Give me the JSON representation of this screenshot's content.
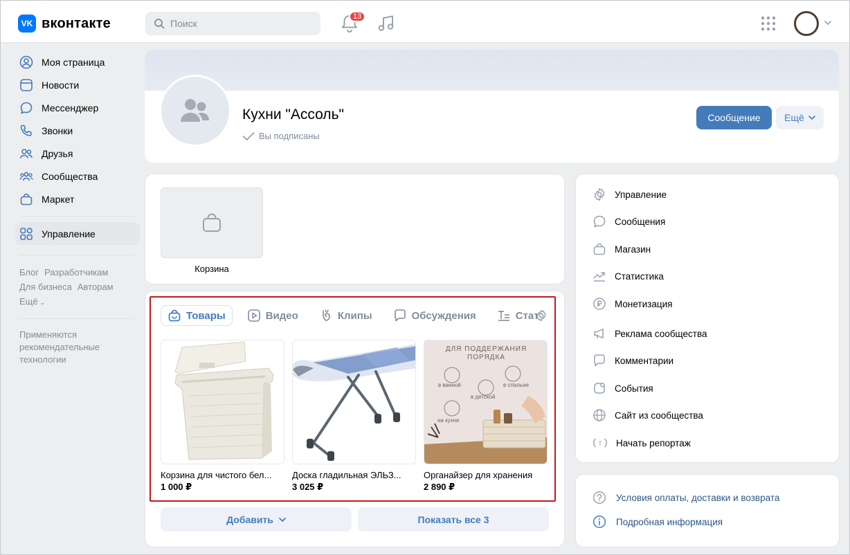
{
  "header": {
    "logo_badge": "VK",
    "logo_text": "вконтакте",
    "search_placeholder": "Поиск",
    "notifications_count": "13",
    "brand_color": "#0077ff"
  },
  "sidebar": {
    "items": [
      {
        "label": "Моя страница",
        "icon": "user-circle-icon"
      },
      {
        "label": "Новости",
        "icon": "newsfeed-icon"
      },
      {
        "label": "Мессенджер",
        "icon": "message-icon"
      },
      {
        "label": "Звонки",
        "icon": "phone-icon"
      },
      {
        "label": "Друзья",
        "icon": "friends-icon"
      },
      {
        "label": "Сообщества",
        "icon": "communities-icon"
      },
      {
        "label": "Маркет",
        "icon": "shopping-bag-icon"
      }
    ],
    "manage": {
      "label": "Управление",
      "icon": "grid-icon"
    },
    "footer_links": [
      "Блог",
      "Разработчикам",
      "Для бизнеса",
      "Авторам",
      "Ещё"
    ],
    "note": "Применяются рекомендательные технологии"
  },
  "group": {
    "name": "Кухни \"Ассоль\"",
    "status": "Вы подписаны",
    "message_button": "Сообщение",
    "more_button": "Ещё"
  },
  "cart": {
    "label": "Корзина"
  },
  "goods": {
    "tabs": [
      {
        "label": "Товары",
        "icon": "bag-icon",
        "active": true
      },
      {
        "label": "Видео",
        "icon": "video-icon",
        "active": false
      },
      {
        "label": "Клипы",
        "icon": "clips-icon",
        "active": false
      },
      {
        "label": "Обсуждения",
        "icon": "discussion-icon",
        "active": false
      },
      {
        "label": "Стат",
        "icon": "article-icon",
        "active": false
      }
    ],
    "products": [
      {
        "title": "Корзина для чистого бел...",
        "price": "1 000 ₽"
      },
      {
        "title": "Доска гладильная ЭЛЬЗ...",
        "price": "3 025 ₽"
      },
      {
        "title": "Органайзер для хранения",
        "price": "2 890 ₽"
      }
    ],
    "organizer_image": {
      "headline_1": "ДЛЯ ПОДДЕРЖАНИЯ",
      "headline_2": "ПОРЯДКА",
      "labels": [
        "в ванной",
        "в детской",
        "в спальне",
        "на кухне"
      ]
    },
    "add_button": "Добавить",
    "show_all_button": "Показать все 3"
  },
  "right_menu": {
    "items": [
      {
        "label": "Управление",
        "icon": "gear-icon"
      },
      {
        "label": "Сообщения",
        "icon": "message-icon"
      },
      {
        "label": "Магазин",
        "icon": "shop-bag-icon"
      },
      {
        "label": "Статистика",
        "icon": "chart-icon"
      },
      {
        "label": "Монетизация",
        "icon": "ruble-icon"
      },
      {
        "label": "Реклама сообщества",
        "icon": "megaphone-icon"
      },
      {
        "label": "Комментарии",
        "icon": "comment-icon"
      },
      {
        "label": "События",
        "icon": "event-icon"
      },
      {
        "label": "Сайт из сообщества",
        "icon": "globe-icon"
      },
      {
        "label": "Начать репортаж",
        "icon": "broadcast-icon"
      }
    ]
  },
  "info": {
    "items": [
      {
        "label": "Условия оплаты, доставки и возврата",
        "icon": "question-icon"
      },
      {
        "label": "Подробная информация",
        "icon": "info-icon"
      }
    ]
  }
}
